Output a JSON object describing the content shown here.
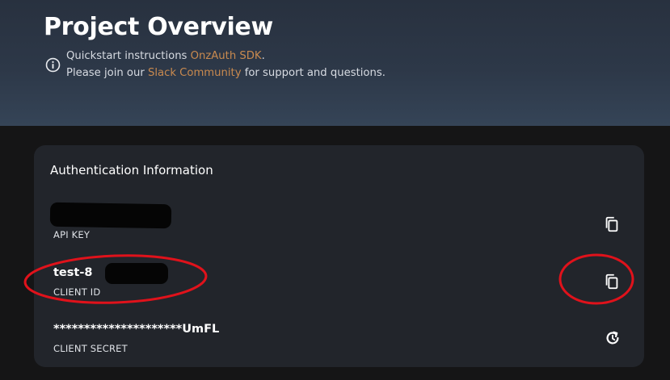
{
  "header": {
    "title": "Project Overview",
    "line1_prefix": "Quickstart instructions ",
    "line1_link": "OnzAuth SDK",
    "line1_suffix": ".",
    "line2_prefix": "Please join our ",
    "line2_link": "Slack Community",
    "line2_suffix": " for support and questions."
  },
  "auth_card": {
    "title": "Authentication Information",
    "fields": [
      {
        "value": "",
        "label": "API KEY",
        "action_icon": "copy-icon"
      },
      {
        "value": "test-8",
        "label": "CLIENT ID",
        "action_icon": "copy-icon"
      },
      {
        "value": "*********************UmFL",
        "label": "CLIENT SECRET",
        "action_icon": "refresh-icon"
      }
    ]
  },
  "colors": {
    "link": "#c98a4f",
    "annotation": "#e0121b",
    "card": "#22252b",
    "background": "#151516"
  }
}
